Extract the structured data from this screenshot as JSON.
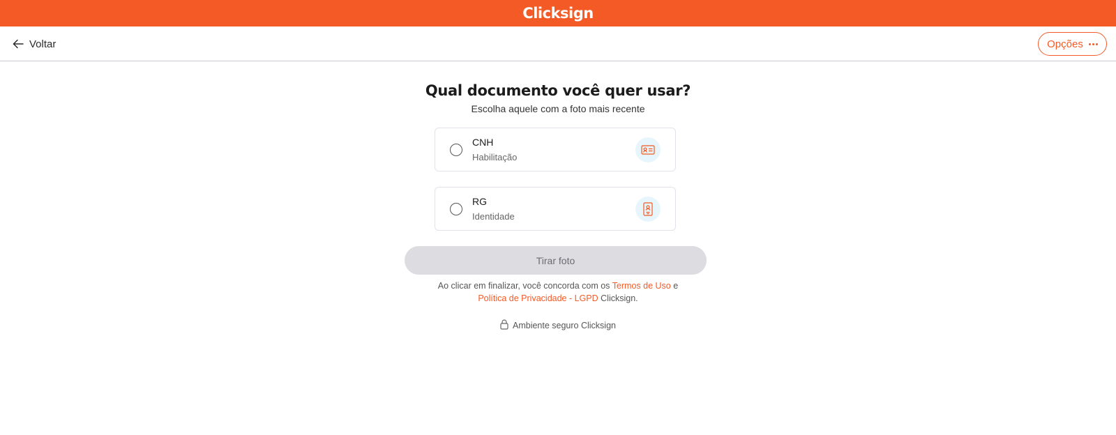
{
  "header": {
    "brand": "Clicksign"
  },
  "nav": {
    "back_label": "Voltar",
    "options_label": "Opções"
  },
  "page": {
    "title": "Qual documento você quer usar?",
    "subtitle": "Escolha aquele com a foto mais recente"
  },
  "documents": [
    {
      "title": "CNH",
      "subtitle": "Habilitação",
      "icon": "id-card-icon"
    },
    {
      "title": "RG",
      "subtitle": "Identidade",
      "icon": "id-badge-icon"
    }
  ],
  "actions": {
    "take_photo_label": "Tirar foto"
  },
  "terms": {
    "prefix": "Ao clicar em finalizar, você concorda com os",
    "terms_link": "Termos de Uso",
    "conjunction": "e",
    "privacy_link": "Política de Privacidade - LGPD",
    "suffix": "Clicksign."
  },
  "footer": {
    "secure_label": "Ambiente seguro Clicksign"
  },
  "colors": {
    "brand": "#f45a26",
    "button_disabled": "#dcdce1",
    "icon_bg": "#e6f6fc"
  }
}
